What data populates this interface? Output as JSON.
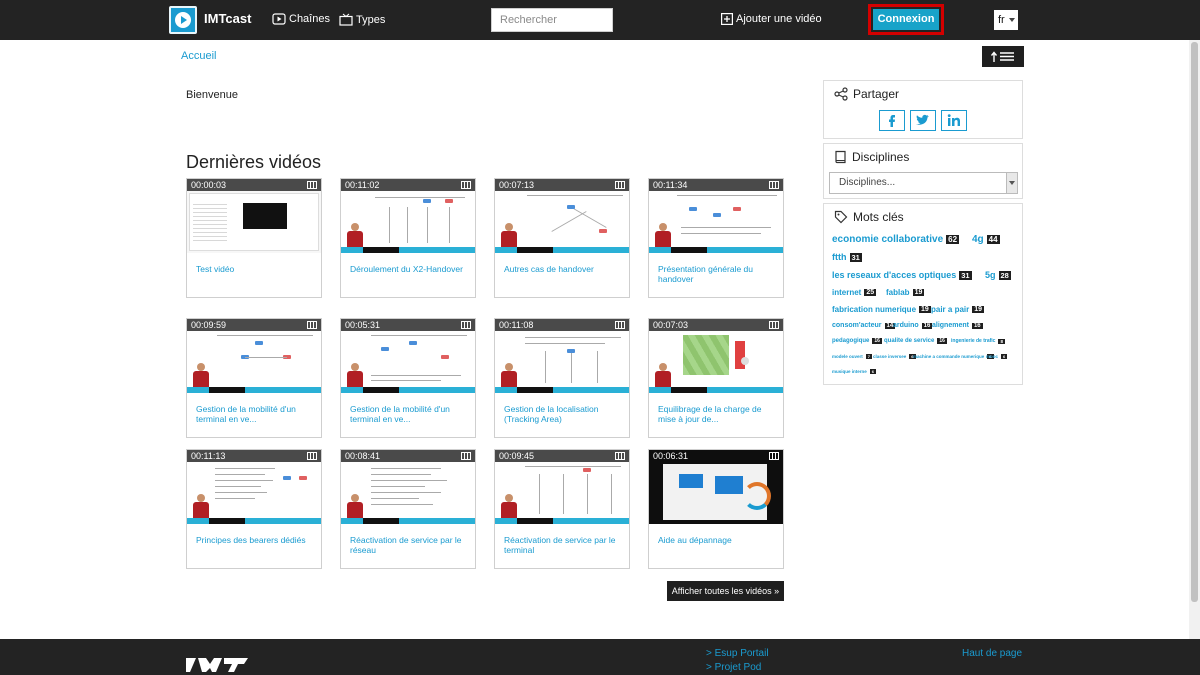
{
  "header": {
    "brand": "IMTcast",
    "nav_channels": "Chaînes",
    "nav_types": "Types",
    "search_placeholder": "Rechercher",
    "add_video": "Ajouter une vidéo",
    "login": "Connexion",
    "language": "fr"
  },
  "breadcrumb": "Accueil",
  "welcome": "Bienvenue",
  "section_title": "Dernières vidéos",
  "videos": [
    {
      "duration": "00:00:03",
      "title": "Test vidéo"
    },
    {
      "duration": "00:11:02",
      "title": "Déroulement du X2-Handover"
    },
    {
      "duration": "00:07:13",
      "title": "Autres cas de handover"
    },
    {
      "duration": "00:11:34",
      "title": "Présentation générale du handover"
    },
    {
      "duration": "00:09:59",
      "title": "Gestion de la mobilité d'un terminal en ve..."
    },
    {
      "duration": "00:05:31",
      "title": "Gestion de la mobilité d'un terminal en ve..."
    },
    {
      "duration": "00:11:08",
      "title": "Gestion de la localisation (Tracking Area)"
    },
    {
      "duration": "00:07:03",
      "title": "Equilibrage de la charge de mise à jour de..."
    },
    {
      "duration": "00:11:13",
      "title": "Principes des bearers dédiés"
    },
    {
      "duration": "00:08:41",
      "title": "Réactivation de service par le réseau"
    },
    {
      "duration": "00:09:45",
      "title": "Réactivation de service par le terminal"
    },
    {
      "duration": "00:06:31",
      "title": "Aide au dépannage"
    }
  ],
  "all_videos_button": "Afficher toutes les vidéos »",
  "sidebar": {
    "share_title": "Partager",
    "disciplines_title": "Disciplines",
    "disciplines_select": "Disciplines...",
    "keywords_title": "Mots clés",
    "tags": [
      {
        "label": "economie collaborative",
        "count": "62"
      },
      {
        "label": "4g",
        "count": "44"
      },
      {
        "label": "ftth",
        "count": "31"
      },
      {
        "label": "les reseaux d'acces optiques",
        "count": "31"
      },
      {
        "label": "5g",
        "count": "28"
      },
      {
        "label": "internet",
        "count": "25"
      },
      {
        "label": "fablab",
        "count": "19"
      },
      {
        "label": "fabrication numerique",
        "count": "19"
      },
      {
        "label": "pair a pair",
        "count": "19"
      },
      {
        "label": "consom'acteur",
        "count": "14"
      },
      {
        "label": "arduino",
        "count": "16"
      },
      {
        "label": "alignement",
        "count": "16"
      },
      {
        "label": "pedagogique",
        "count": "16"
      },
      {
        "label": "qualite de service",
        "count": "16"
      },
      {
        "label": "ingenierie de trafic",
        "count": "8"
      },
      {
        "label": "modele ouvert",
        "count": "7"
      },
      {
        "label": "classe inversee",
        "count": "6"
      },
      {
        "label": "machine a commande numerique",
        "count": "6"
      },
      {
        "label": "mooc",
        "count": "6"
      },
      {
        "label": "musique interne",
        "count": "6"
      }
    ]
  },
  "footer": {
    "link_esup": "> Esup Portail",
    "link_pod": "> Projet Pod",
    "top_link": "Haut de page"
  },
  "colors": {
    "topbar": "#232323",
    "accent": "#1a9bd0",
    "login_bg": "#18a3c9",
    "login_outline": "#d40000"
  }
}
